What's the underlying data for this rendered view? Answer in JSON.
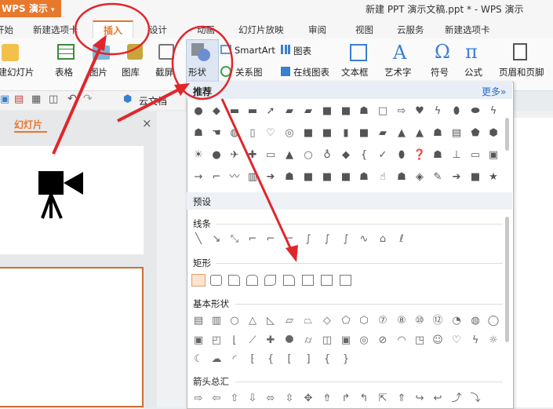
{
  "window": {
    "app_name": "WPS 演示",
    "title": "新建 PPT 演示文稿.ppt * - WPS 演示"
  },
  "tabs": [
    "开始",
    "新建选项卡",
    "插入",
    "设计",
    "动画",
    "幻灯片放映",
    "审阅",
    "视图",
    "云服务",
    "新建选项卡"
  ],
  "ribbon": {
    "new_slide": "新建幻灯片",
    "table": "表格",
    "picture": "图片",
    "gallery": "图库",
    "screenshot": "截屏",
    "shapes": "形状",
    "smartart": "SmartArt",
    "relation": "关系图",
    "chart": "图表",
    "online_chart": "在线图表",
    "textbox": "文本框",
    "wordart": "艺术字",
    "symbol": "符号",
    "formula": "公式",
    "header_footer": "页眉和页脚"
  },
  "quickbar": {
    "cloud_doc": "云文档"
  },
  "slide_pane": {
    "tab_label": "幻灯片",
    "close": "×"
  },
  "shapes_panel": {
    "recommended": "推荐",
    "more": "更多",
    "preset": "预设",
    "lines": "线条",
    "rectangles": "矩形",
    "basic_shapes": "基本形状",
    "block_arrows": "箭头总汇"
  },
  "colors": {
    "accent": "#e7782c",
    "annotation": "#e0262c",
    "link": "#2a6fc7"
  },
  "annotations": [
    "circle-insert-tab",
    "circle-shapes-button",
    "arrow-to-insert",
    "arrow-to-shapes",
    "arrow-to-rectangle"
  ]
}
